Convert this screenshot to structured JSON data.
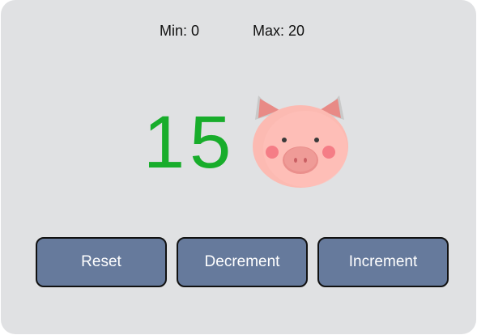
{
  "range": {
    "min_label": "Min: 0",
    "max_label": "Max: 20"
  },
  "counter": {
    "value": "15",
    "color": "#18ad2b"
  },
  "mascot_icon": "pig-face-icon",
  "buttons": {
    "reset_label": "Reset",
    "decrement_label": "Decrement",
    "increment_label": "Increment",
    "color": "#667a9c"
  }
}
